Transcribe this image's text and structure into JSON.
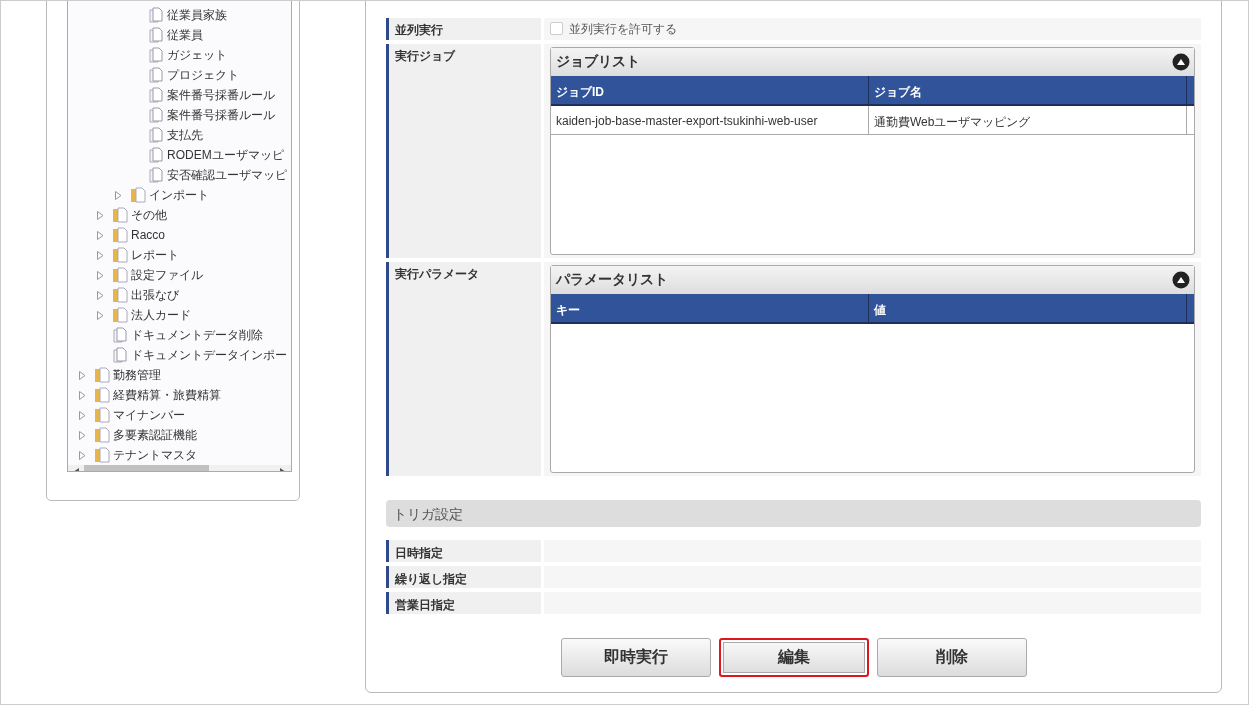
{
  "tree": {
    "items": [
      {
        "children": [
          {
            "children": [
              {
                "children": [
                  {
                    "label": "従業員家族",
                    "kind": "file"
                  },
                  {
                    "label": "従業員",
                    "kind": "file"
                  },
                  {
                    "label": "ガジェット",
                    "kind": "file"
                  },
                  {
                    "label": "プロジェクト",
                    "kind": "file"
                  },
                  {
                    "label": "案件番号採番ルール",
                    "kind": "file"
                  },
                  {
                    "label": "案件番号採番ルール",
                    "kind": "file"
                  },
                  {
                    "label": "支払先",
                    "kind": "file"
                  },
                  {
                    "label": "RODEMユーザマッピ",
                    "kind": "file"
                  },
                  {
                    "label": "安否確認ユーザマッピ",
                    "kind": "file"
                  }
                ]
              },
              {
                "label": "インポート",
                "kind": "folder",
                "expanded": false
              }
            ]
          },
          {
            "label": "その他",
            "kind": "folder",
            "expanded": false
          },
          {
            "label": "Racco",
            "kind": "folder",
            "expanded": false
          },
          {
            "label": "レポート",
            "kind": "folder",
            "expanded": false
          },
          {
            "label": "設定ファイル",
            "kind": "folder",
            "expanded": false
          },
          {
            "label": "出張なび",
            "kind": "folder",
            "expanded": false
          },
          {
            "label": "法人カード",
            "kind": "folder",
            "expanded": false
          },
          {
            "label": "ドキュメントデータ削除",
            "kind": "file"
          },
          {
            "label": "ドキュメントデータインポー",
            "kind": "file"
          }
        ]
      },
      {
        "label": "勤務管理",
        "kind": "folder",
        "expanded": false
      },
      {
        "label": "経費精算・旅費精算",
        "kind": "folder",
        "expanded": false
      },
      {
        "label": "マイナンバー",
        "kind": "folder",
        "expanded": false
      },
      {
        "label": "多要素認証機能",
        "kind": "folder",
        "expanded": false
      },
      {
        "label": "テナントマスタ",
        "kind": "folder",
        "expanded": false
      }
    ]
  },
  "form": {
    "parallel": {
      "label": "並列実行",
      "checkbox_label": "並列実行を許可する",
      "checked": false
    },
    "jobs": {
      "label": "実行ジョブ",
      "panel_title": "ジョブリスト",
      "expanded": true,
      "columns": [
        "ジョブID",
        "ジョブ名"
      ],
      "rows": [
        [
          "kaiden-job-base-master-export-tsukinhi-web-user",
          "通勤費Webユーザマッピング"
        ]
      ]
    },
    "params": {
      "label": "実行パラメータ",
      "panel_title": "パラメータリスト",
      "expanded": true,
      "columns": [
        "キー",
        "値"
      ]
    }
  },
  "trigger": {
    "title": "トリガ設定",
    "rows": [
      "日時指定",
      "繰り返し指定",
      "営業日指定"
    ]
  },
  "buttons": [
    {
      "label": "即時実行",
      "focused": false
    },
    {
      "label": "編集",
      "focused": true
    },
    {
      "label": "削除",
      "focused": false
    }
  ]
}
